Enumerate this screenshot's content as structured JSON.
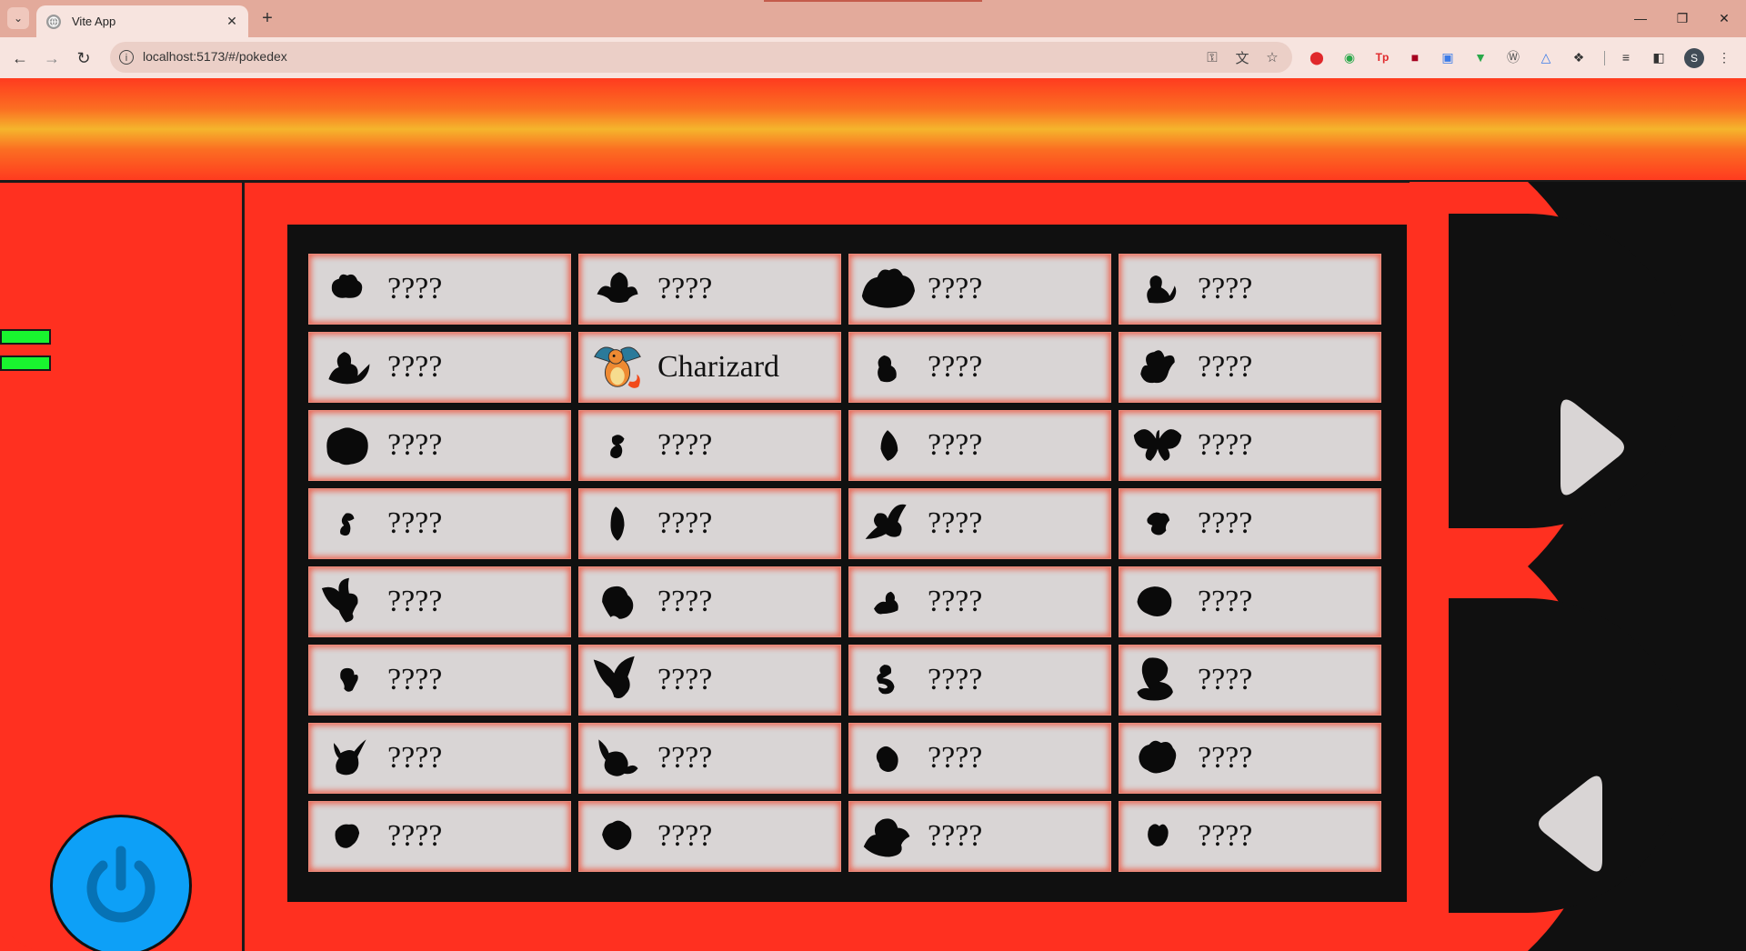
{
  "browser": {
    "tab_title": "Vite App",
    "url": "localhost:5173/#/pokedex",
    "profile_initial": "S"
  },
  "colors": {
    "body_red": "#ff3020",
    "screen_black": "#101010",
    "card_gray": "#d9d5d5",
    "indicator_green": "#19f52f",
    "power_blue": "#0da0f7",
    "arrow_gray": "#d9d5d5"
  },
  "indicators": [
    "green",
    "green"
  ],
  "pokedex": {
    "entries": [
      {
        "name": "????",
        "icon": "silhouette-bulbasaur",
        "revealed": false
      },
      {
        "name": "????",
        "icon": "silhouette-ivysaur",
        "revealed": false
      },
      {
        "name": "????",
        "icon": "silhouette-venusaur",
        "revealed": false
      },
      {
        "name": "????",
        "icon": "silhouette-charmander",
        "revealed": false
      },
      {
        "name": "????",
        "icon": "silhouette-charmeleon",
        "revealed": false
      },
      {
        "name": "Charizard",
        "icon": "charizard-sprite",
        "revealed": true
      },
      {
        "name": "????",
        "icon": "silhouette-squirtle",
        "revealed": false
      },
      {
        "name": "????",
        "icon": "silhouette-wartortle",
        "revealed": false
      },
      {
        "name": "????",
        "icon": "silhouette-blastoise",
        "revealed": false
      },
      {
        "name": "????",
        "icon": "silhouette-caterpie",
        "revealed": false
      },
      {
        "name": "????",
        "icon": "silhouette-metapod",
        "revealed": false
      },
      {
        "name": "????",
        "icon": "silhouette-butterfree",
        "revealed": false
      },
      {
        "name": "????",
        "icon": "silhouette-weedle",
        "revealed": false
      },
      {
        "name": "????",
        "icon": "silhouette-kakuna",
        "revealed": false
      },
      {
        "name": "????",
        "icon": "silhouette-beedrill",
        "revealed": false
      },
      {
        "name": "????",
        "icon": "silhouette-pidgey",
        "revealed": false
      },
      {
        "name": "????",
        "icon": "silhouette-pidgeotto",
        "revealed": false
      },
      {
        "name": "????",
        "icon": "silhouette-pidgeot",
        "revealed": false
      },
      {
        "name": "????",
        "icon": "silhouette-rattata",
        "revealed": false
      },
      {
        "name": "????",
        "icon": "silhouette-raticate",
        "revealed": false
      },
      {
        "name": "????",
        "icon": "silhouette-spearow",
        "revealed": false
      },
      {
        "name": "????",
        "icon": "silhouette-fearow",
        "revealed": false
      },
      {
        "name": "????",
        "icon": "silhouette-ekans",
        "revealed": false
      },
      {
        "name": "????",
        "icon": "silhouette-arbok",
        "revealed": false
      },
      {
        "name": "????",
        "icon": "silhouette-pikachu",
        "revealed": false
      },
      {
        "name": "????",
        "icon": "silhouette-raichu",
        "revealed": false
      },
      {
        "name": "????",
        "icon": "silhouette-sandshrew",
        "revealed": false
      },
      {
        "name": "????",
        "icon": "silhouette-sandslash",
        "revealed": false
      },
      {
        "name": "????",
        "icon": "silhouette-nidoran-f",
        "revealed": false
      },
      {
        "name": "????",
        "icon": "silhouette-nidorina",
        "revealed": false
      },
      {
        "name": "????",
        "icon": "silhouette-nidoqueen",
        "revealed": false
      },
      {
        "name": "????",
        "icon": "silhouette-nidoran-m",
        "revealed": false
      }
    ]
  },
  "controls": {
    "next_icon": "arrow-right-icon",
    "prev_icon": "arrow-left-icon",
    "power_icon": "power-icon"
  }
}
